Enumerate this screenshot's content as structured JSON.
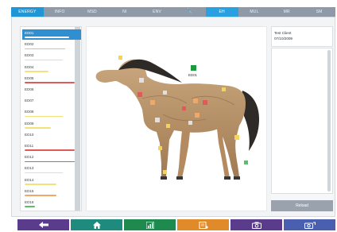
{
  "top_tabs": [
    {
      "label": "ENERGY"
    },
    {
      "label": "INFO"
    },
    {
      "label": "MSD"
    },
    {
      "label": "NI"
    },
    {
      "label": "ENV"
    },
    {
      "label": "",
      "icon": "wrench-icon"
    },
    {
      "label": "EH"
    },
    {
      "label": "MUL"
    },
    {
      "label": "MR"
    },
    {
      "label": "SM"
    }
  ],
  "active_tab_index": 0,
  "selected_tab_index": 6,
  "left_list": [
    {
      "label": "ED01",
      "bar_color": "#ffffff",
      "bar_fraction": 0.85,
      "active": true
    },
    {
      "label": "ED02",
      "bar_color": "#f0b87a",
      "bar_fraction": 0.78
    },
    {
      "label": "ED03",
      "bar_color": "#f2e27a",
      "bar_fraction": 0.72
    },
    {
      "label": "ED04",
      "bar_color": "#f2e27a",
      "bar_fraction": 0.45
    },
    {
      "label": "ED05",
      "bar_color": "#e05a5a",
      "bar_fraction": 0.96
    },
    {
      "label": "ED06",
      "bar_color": "#e6e6e6",
      "bar_fraction": 0.0
    },
    {
      "label": "ED07",
      "bar_color": "#e6e6e6",
      "bar_fraction": 0.0
    },
    {
      "label": "ED08",
      "bar_color": "#f2e27a",
      "bar_fraction": 0.72
    },
    {
      "label": "ED09",
      "bar_color": "#f2e27a",
      "bar_fraction": 0.5
    },
    {
      "label": "ED10",
      "bar_color": "#e6e6e6",
      "bar_fraction": 0.0
    },
    {
      "label": "ED11",
      "bar_color": "#e05a5a",
      "bar_fraction": 0.96
    },
    {
      "label": "ED12",
      "bar_color": "#e05a5a",
      "bar_fraction": 0.96
    },
    {
      "label": "ED13",
      "bar_color": "#f2e27a",
      "bar_fraction": 0.72
    },
    {
      "label": "ED14",
      "bar_color": "#f2e27a",
      "bar_fraction": 0.6
    },
    {
      "label": "ED15",
      "bar_color": "#f0a86a",
      "bar_fraction": 0.6
    },
    {
      "label": "ED16",
      "bar_color": "#5abf6a",
      "bar_fraction": 0.2
    }
  ],
  "model": {
    "callout_label": "ED01",
    "callout_color": "#1e9a3c"
  },
  "right_panel": {
    "client_name": "Test Client",
    "date": "07/10/2009",
    "reload_label": "Reload"
  },
  "toolbar": [
    {
      "icon": "back-arrow-icon",
      "color": "#5a3b8c"
    },
    {
      "icon": "home-icon",
      "color": "#1f8a7e"
    },
    {
      "icon": "chart-icon",
      "color": "#1f8a4e"
    },
    {
      "icon": "document-icon",
      "color": "#e08a2a"
    },
    {
      "icon": "camera-icon",
      "color": "#5a3b8c"
    },
    {
      "icon": "camera-switch-icon",
      "color": "#4a5fb0"
    }
  ]
}
